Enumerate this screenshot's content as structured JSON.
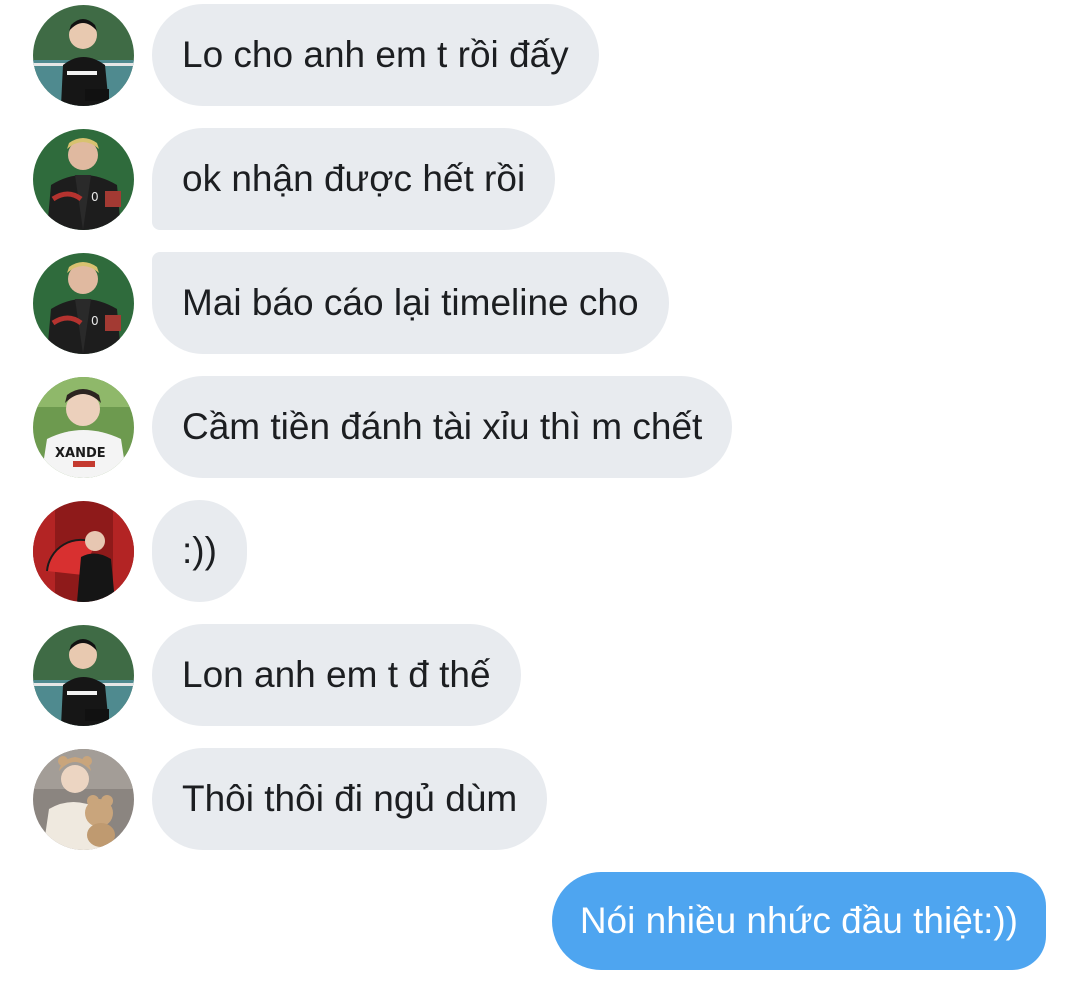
{
  "conversation": {
    "messages": [
      {
        "sender": "friend-1",
        "avatar": "avatar-boy-court",
        "text": "Lo cho anh em t rồi đấy"
      },
      {
        "sender": "friend-2",
        "avatar": "avatar-varsity-jacket",
        "text": "ok nhận được hết rồi"
      },
      {
        "sender": "friend-2",
        "avatar": "avatar-varsity-jacket",
        "text": "Mai báo cáo lại timeline cho"
      },
      {
        "sender": "friend-3",
        "avatar": "avatar-baseball-jersey",
        "text": "Cầm tiền đánh tài xỉu thì m chết"
      },
      {
        "sender": "friend-4",
        "avatar": "avatar-red-fan",
        "text": ":))"
      },
      {
        "sender": "friend-1",
        "avatar": "avatar-boy-court",
        "text": "Lon anh em t đ thế"
      },
      {
        "sender": "friend-5",
        "avatar": "avatar-teddy-bear",
        "text": "Thôi thôi đi ngủ dùm"
      }
    ],
    "outgoing": {
      "text": "Nói nhiều nhức đầu thiệt:))"
    }
  },
  "colors": {
    "incoming_bubble": "#e8ebef",
    "outgoing_bubble": "#4ea5f0",
    "incoming_text": "#1c1e21",
    "outgoing_text": "#ffffff"
  }
}
